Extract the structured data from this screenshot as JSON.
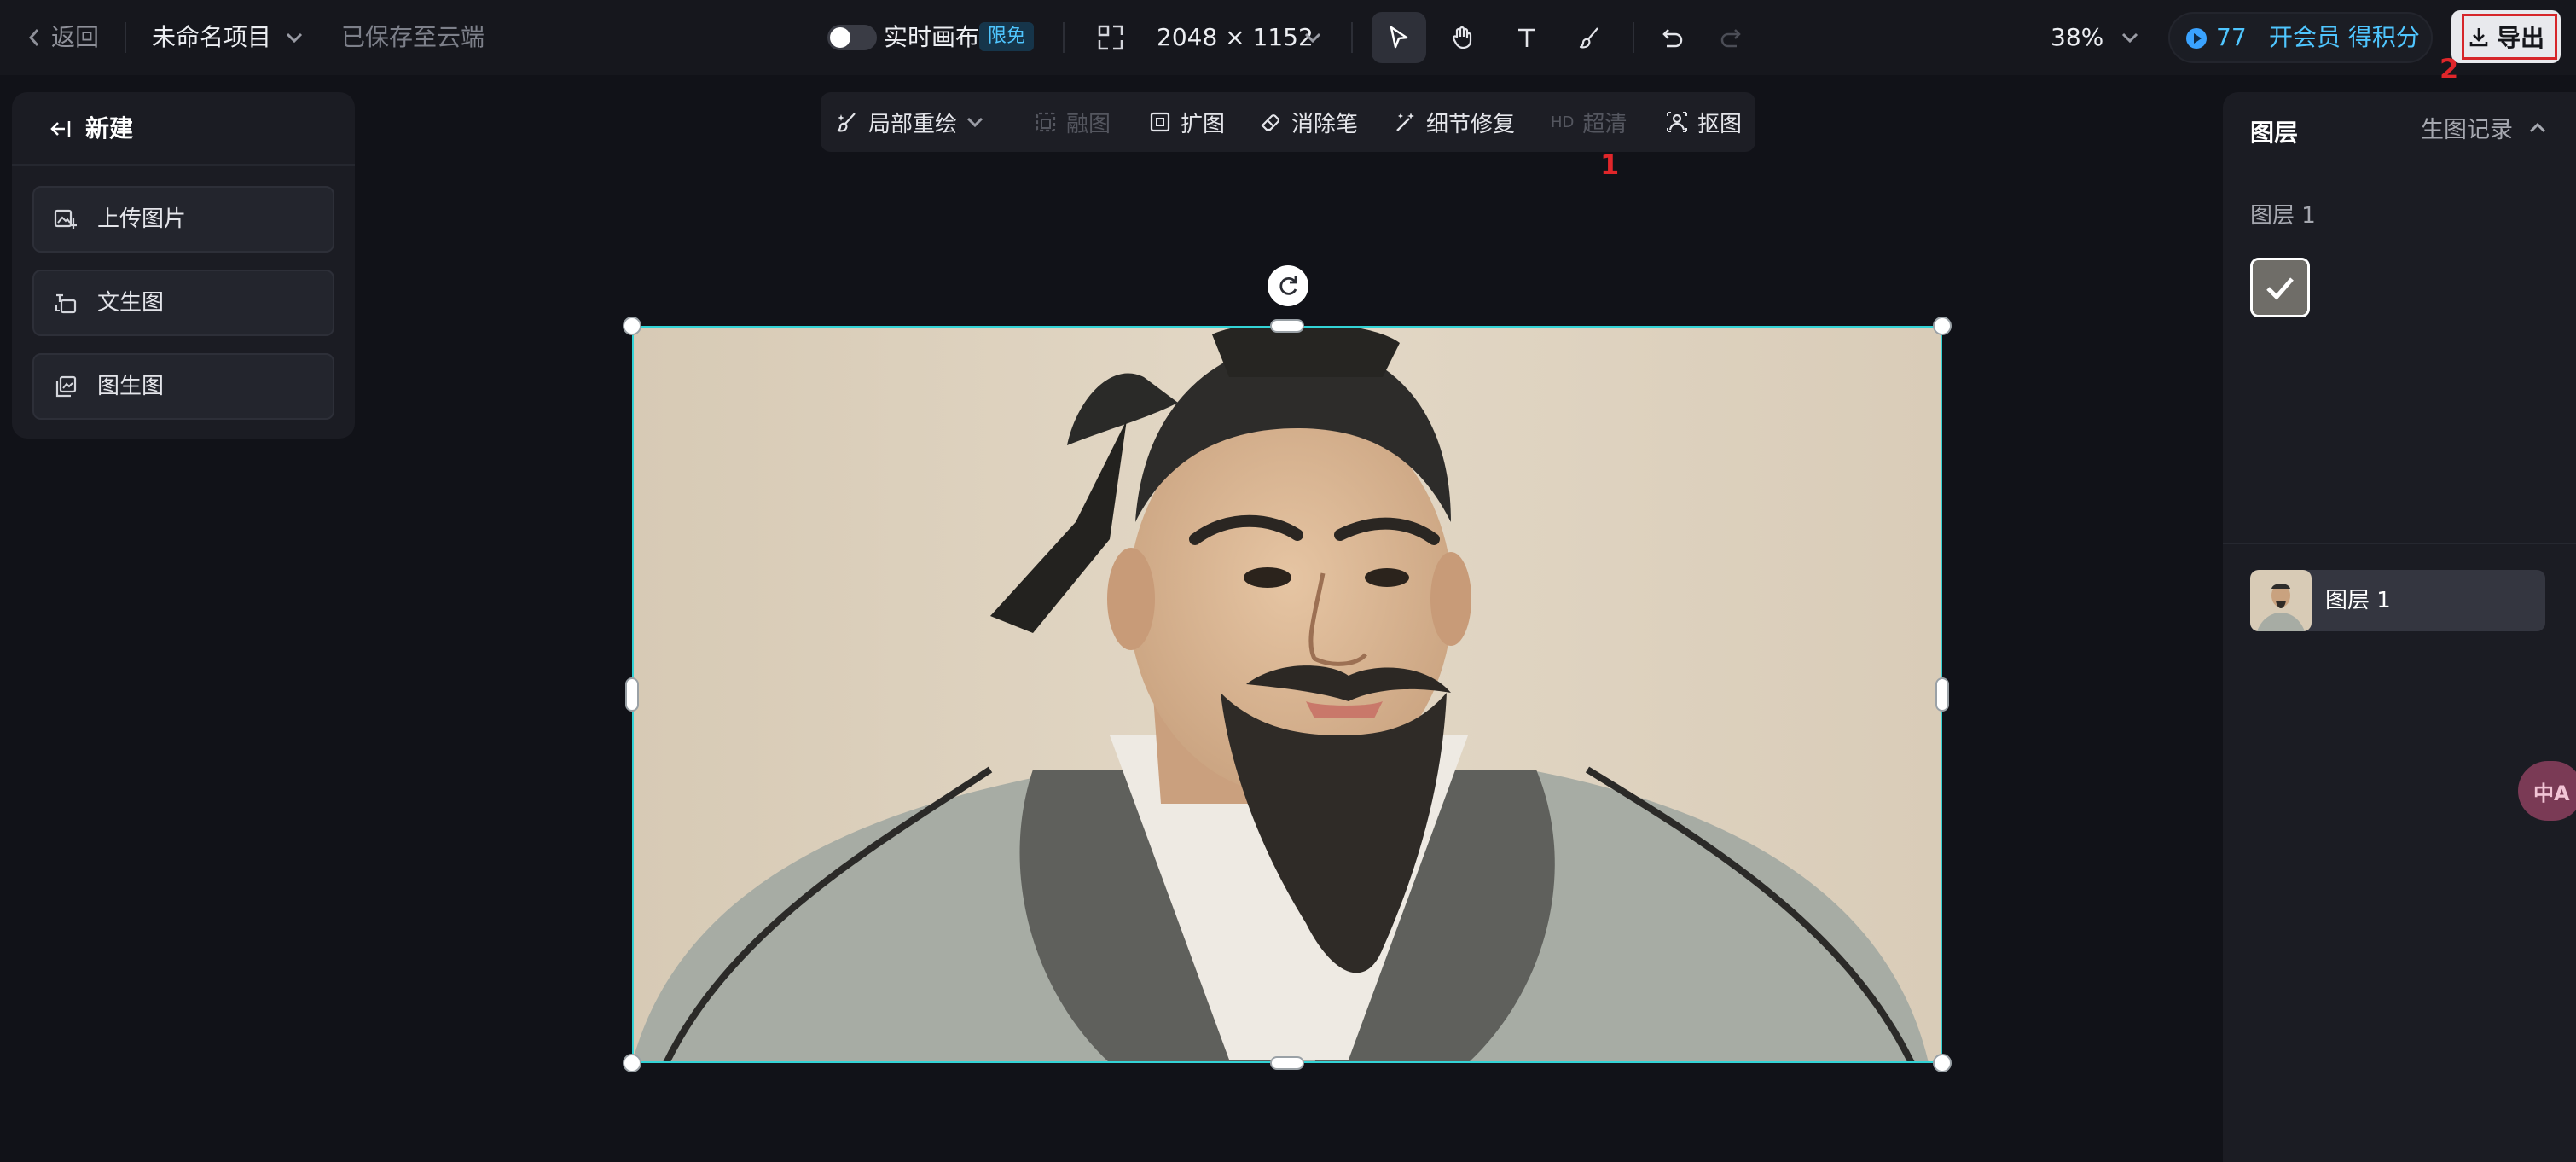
{
  "topbar": {
    "back_label": "返回",
    "project_name": "未命名项目",
    "save_status": "已保存至云端",
    "realtime_label": "实时画布",
    "realtime_badge": "限免",
    "canvas_size": "2048 × 1152",
    "zoom": "38%",
    "credits": "77",
    "member_label": "开会员 得积分",
    "export_label": "导出"
  },
  "annotations": {
    "marker_1": "1",
    "marker_2": "2"
  },
  "left_panel": {
    "header": "新建",
    "items": [
      "上传图片",
      "文生图",
      "图生图"
    ]
  },
  "toolbar": {
    "partial_redraw": "局部重绘",
    "blend": "融图",
    "expand": "扩图",
    "eraser": "消除笔",
    "detail_fix": "细节修复",
    "hd_prefix": "HD",
    "hd_label": "超清",
    "cutout": "抠图"
  },
  "right_panel": {
    "title": "图层",
    "history_label": "生图记录",
    "group_label": "图层 1",
    "layer_name": "图层 1"
  },
  "translate_fab": "中A",
  "colors": {
    "background": "#111218",
    "selection": "#33d3d6",
    "accent": "#4fc6ff",
    "annotation": "#d6262a"
  }
}
